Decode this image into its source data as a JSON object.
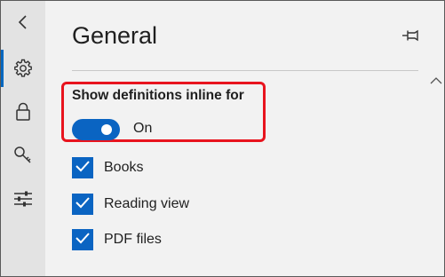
{
  "sidebar": {
    "items": [
      {
        "name": "back",
        "icon": "chevron-left-icon"
      },
      {
        "name": "general",
        "icon": "gear-icon",
        "active": true
      },
      {
        "name": "privacy",
        "icon": "lock-icon"
      },
      {
        "name": "passwords",
        "icon": "key-icon"
      },
      {
        "name": "advanced",
        "icon": "sliders-icon"
      }
    ]
  },
  "main": {
    "title": "General",
    "pin_icon": "pin-icon",
    "scroll_icon": "chevron-up-icon",
    "definitions": {
      "label": "Show definitions inline for",
      "toggle_state": "On",
      "toggle_on": true,
      "highlight_color": "#e8141e"
    },
    "checkboxes": [
      {
        "label": "Books",
        "checked": true
      },
      {
        "label": "Reading view",
        "checked": true
      },
      {
        "label": "PDF files",
        "checked": true
      }
    ]
  },
  "colors": {
    "accent": "#0a64c2",
    "rail_background": "#e3e3e3",
    "panel_background": "#f2f2f2"
  }
}
